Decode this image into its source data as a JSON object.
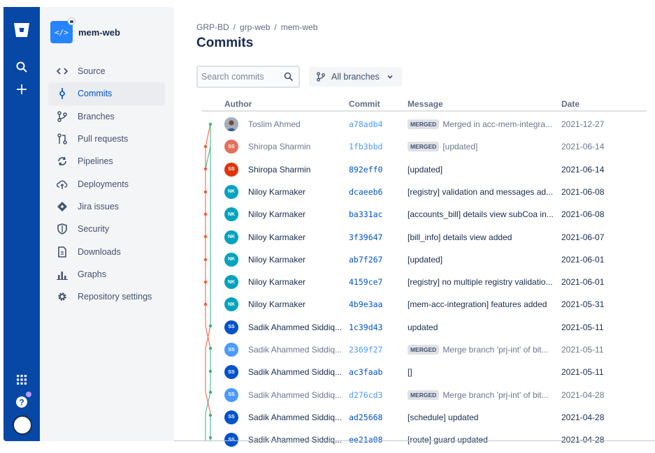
{
  "sidebar": {
    "repo_name": "mem-web",
    "repo_icon_text": "</>",
    "items": [
      {
        "label": "Source",
        "icon": "code-icon"
      },
      {
        "label": "Commits",
        "icon": "commit-icon",
        "active": true
      },
      {
        "label": "Branches",
        "icon": "branch-icon"
      },
      {
        "label": "Pull requests",
        "icon": "pull-request-icon"
      },
      {
        "label": "Pipelines",
        "icon": "pipelines-icon"
      },
      {
        "label": "Deployments",
        "icon": "cloud-upload-icon"
      },
      {
        "label": "Jira issues",
        "icon": "jira-icon"
      },
      {
        "label": "Security",
        "icon": "shield-icon"
      },
      {
        "label": "Downloads",
        "icon": "document-icon"
      },
      {
        "label": "Graphs",
        "icon": "bar-chart-icon"
      },
      {
        "label": "Repository settings",
        "icon": "gear-icon"
      }
    ]
  },
  "header": {
    "breadcrumb": [
      "GRP-BD",
      "grp-web",
      "mem-web"
    ],
    "breadcrumb_sep": "/",
    "title": "Commits"
  },
  "toolbar": {
    "search_placeholder": "Search commits",
    "branches_label": "All branches"
  },
  "table": {
    "columns": [
      "Author",
      "Commit",
      "Message",
      "Date"
    ],
    "rows": [
      {
        "initials": "",
        "author": "Toslim Ahmed",
        "hash": "a78adb4",
        "merged": true,
        "message": "Merged in acc-mem-integra...",
        "date": "2021-12-27",
        "avatar_color": "#8e9aaf"
      },
      {
        "initials": "SS",
        "author": "Shiropa Sharmin",
        "hash": "1fb3bbd",
        "merged": true,
        "message": "[updated]",
        "date": "2021-06-14",
        "avatar_color": "#e2725b"
      },
      {
        "initials": "SS",
        "author": "Shiropa Sharmin",
        "hash": "892eff0",
        "merged": false,
        "message": "[updated]",
        "date": "2021-06-14",
        "avatar_color": "#de350b"
      },
      {
        "initials": "NK",
        "author": "Niloy Karmaker",
        "hash": "dcaeeb6",
        "merged": false,
        "message": "[registry] validation and messages ad...",
        "date": "2021-06-08",
        "avatar_color": "#00a3bf"
      },
      {
        "initials": "NK",
        "author": "Niloy Karmaker",
        "hash": "ba331ac",
        "merged": false,
        "message": "[accounts_bill] details view subCoa in...",
        "date": "2021-06-08",
        "avatar_color": "#00a3bf"
      },
      {
        "initials": "NK",
        "author": "Niloy Karmaker",
        "hash": "3f39647",
        "merged": false,
        "message": "[bill_info] details view added",
        "date": "2021-06-07",
        "avatar_color": "#00a3bf"
      },
      {
        "initials": "NK",
        "author": "Niloy Karmaker",
        "hash": "ab7f267",
        "merged": false,
        "message": "[updated]",
        "date": "2021-06-01",
        "avatar_color": "#00a3bf"
      },
      {
        "initials": "NK",
        "author": "Niloy Karmaker",
        "hash": "4159ce7",
        "merged": false,
        "message": "[registry] no multiple registry validatio...",
        "date": "2021-06-01",
        "avatar_color": "#00a3bf"
      },
      {
        "initials": "NK",
        "author": "Niloy Karmaker",
        "hash": "4b9e3aa",
        "merged": false,
        "message": "[mem-acc-integration] features added",
        "date": "2021-05-31",
        "avatar_color": "#00a3bf"
      },
      {
        "initials": "SS",
        "author": "Sadik Ahammed Siddiq...",
        "hash": "1c39d43",
        "merged": false,
        "message": "updated",
        "date": "2021-05-11",
        "avatar_color": "#0052cc"
      },
      {
        "initials": "SS",
        "author": "Sadik Ahammed Siddiq...",
        "hash": "2369f27",
        "merged": true,
        "message": "Merge branch 'prj-int' of bit...",
        "date": "2021-05-11",
        "avatar_color": "#4c9aff"
      },
      {
        "initials": "SS",
        "author": "Sadik Ahammed Siddiq...",
        "hash": "ac3faab",
        "merged": false,
        "message": "[]",
        "date": "2021-05-11",
        "avatar_color": "#0052cc"
      },
      {
        "initials": "SS",
        "author": "Sadik Ahammed Siddiq...",
        "hash": "d276cd3",
        "merged": true,
        "message": "Merge branch 'prj-int' of bit...",
        "date": "2021-04-28",
        "avatar_color": "#4c9aff"
      },
      {
        "initials": "SS",
        "author": "Sadik Ahammed Siddiq...",
        "hash": "ad25668",
        "merged": false,
        "message": "[schedule] updated",
        "date": "2021-04-28",
        "avatar_color": "#0052cc"
      },
      {
        "initials": "SS",
        "author": "Sadik Ahammed Siddiq...",
        "hash": "ee21a08",
        "merged": false,
        "message": "[route] guard updated",
        "date": "2021-04-28",
        "avatar_color": "#0052cc"
      }
    ]
  },
  "merged_label": "MERGED",
  "colors": {
    "global_nav": "#0747a6",
    "link": "#0052cc",
    "graph_green": "#36b37e",
    "graph_red": "#ff5630"
  }
}
